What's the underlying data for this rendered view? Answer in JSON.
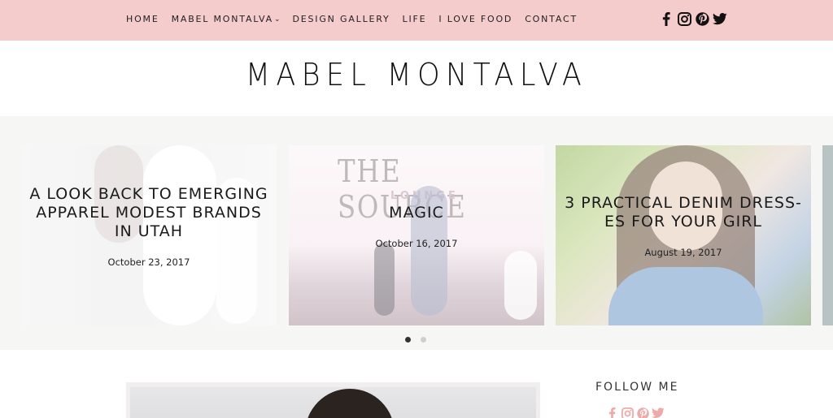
{
  "nav": {
    "items": [
      {
        "label": "HOME"
      },
      {
        "label": "MABEL MONTALVA",
        "has_dropdown": true
      },
      {
        "label": "DESIGN GALLERY"
      },
      {
        "label": "LIFE"
      },
      {
        "label": "I LOVE FOOD"
      },
      {
        "label": "CONTACT"
      }
    ],
    "social_icons": [
      "facebook-icon",
      "instagram-icon",
      "pinterest-icon",
      "twitter-icon"
    ]
  },
  "logo": {
    "text": "MABEL MONTALVA"
  },
  "slider": {
    "slides": [
      {
        "title": "A LOOK BACK TO EMERGING APPAREL MODEST BRANDS IN UTAH",
        "date": "October 23, 2017"
      },
      {
        "title": "MAGIC",
        "date": "October 16, 2017",
        "image_text": "THE SOURCE",
        "image_subtext": "LOUNGE"
      },
      {
        "title": "3 PRACTICAL DENIM DRESSES FOR YOUR GIRL",
        "title_display": "3 PRACTICAL DENIM DRESS- ES FOR YOUR GIRL",
        "date": "August 19, 2017"
      }
    ],
    "dots": 2,
    "active_dot": 0
  },
  "sidebar": {
    "follow_label": "FOLLOW ME",
    "social_icons": [
      "facebook-icon",
      "instagram-icon",
      "pinterest-icon",
      "twitter-icon"
    ]
  },
  "colors": {
    "topbar": "#f4cccb",
    "accent_pink": "#f0a9a9",
    "slider_bg": "#f6f6f4"
  }
}
